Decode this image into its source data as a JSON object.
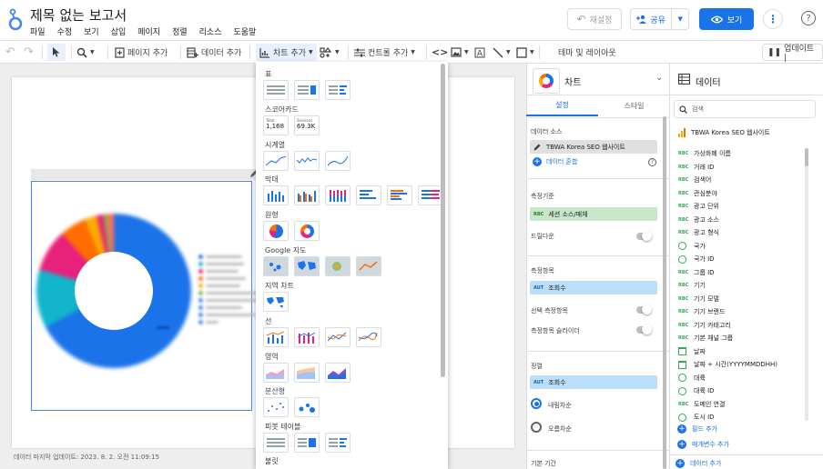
{
  "header": {
    "title": "제목 없는 보고서",
    "menu": [
      "파일",
      "수정",
      "보기",
      "삽입",
      "페이지",
      "정렬",
      "리소스",
      "도움말"
    ],
    "reset_label": "재설정",
    "share_label": "공유",
    "view_label": "보기"
  },
  "toolbar": {
    "add_page": "페이지 추가",
    "add_data": "데이터 추가",
    "add_chart": "차트 추가",
    "add_control": "컨트롤 추가",
    "theme_layout": "테마 및 레이아웃",
    "update": "업데이트 |"
  },
  "canvas": {
    "footer": "데이터 마지막 업데이트: 2023. 8. 2. 오전 11:09:15"
  },
  "chart_picker": {
    "sections": [
      "표",
      "스코어카드",
      "시계열",
      "막대",
      "원형",
      "Google 지도",
      "지역 차트",
      "선",
      "영역",
      "분산형",
      "피봇 테이블",
      "불릿"
    ],
    "scorecard_1_label": "Total",
    "scorecard_1_value": "1,168",
    "scorecard_2_label": "Sessions",
    "scorecard_2_value": "69.3K"
  },
  "props": {
    "chart_type": "차트",
    "tab_setup": "설정",
    "tab_style": "스타일",
    "data_source_label": "데이터 소스",
    "data_source": "TBWA Korea SEO 웹사이트",
    "blend_data": "데이터 혼합",
    "dimension_label": "측정기준",
    "dimension_value": "세션 소스/매체",
    "dimension_tag": "RBC",
    "drilldown": "드릴다운",
    "metric_label": "측정항목",
    "metric_value": "조회수",
    "metric_tag": "AUT",
    "optional_metrics": "선택 측정항목",
    "metric_slider": "측정항목 슬라이더",
    "sort_label": "정렬",
    "sort_value": "조회수",
    "sort_tag": "AUT",
    "descending": "내림차순",
    "ascending": "오름차순",
    "default_range": "기본 기간"
  },
  "data_panel": {
    "title": "데이터",
    "search_placeholder": "검색",
    "source": "TBWA Korea SEO 웹사이트",
    "fields": [
      {
        "tag": "RBC",
        "name": "가상화폐 이름"
      },
      {
        "tag": "RBC",
        "name": "거래 ID"
      },
      {
        "tag": "RBC",
        "name": "검색어"
      },
      {
        "tag": "RBC",
        "name": "관심분야"
      },
      {
        "tag": "RBC",
        "name": "광고 단위"
      },
      {
        "tag": "RBC",
        "name": "광고 소스"
      },
      {
        "tag": "RBC",
        "name": "광고 형식"
      },
      {
        "tag": "globe",
        "name": "국가"
      },
      {
        "tag": "globe",
        "name": "국가 ID"
      },
      {
        "tag": "RBC",
        "name": "그룹 ID"
      },
      {
        "tag": "RBC",
        "name": "기기"
      },
      {
        "tag": "RBC",
        "name": "기기 모델"
      },
      {
        "tag": "RBC",
        "name": "기기 브랜드"
      },
      {
        "tag": "RBC",
        "name": "기기 카테고리"
      },
      {
        "tag": "RBC",
        "name": "기본 채널 그룹"
      },
      {
        "tag": "cal",
        "name": "날짜"
      },
      {
        "tag": "cal",
        "name": "날짜 + 시간(YYYYMMDDHH)"
      },
      {
        "tag": "globe",
        "name": "대륙"
      },
      {
        "tag": "globe",
        "name": "대륙 ID"
      },
      {
        "tag": "RBC",
        "name": "도메인 연결"
      },
      {
        "tag": "globe",
        "name": "도시 ID"
      }
    ],
    "add_field": "필드 추가",
    "add_param": "매개변수 추가",
    "add_data": "데이터 추가"
  }
}
